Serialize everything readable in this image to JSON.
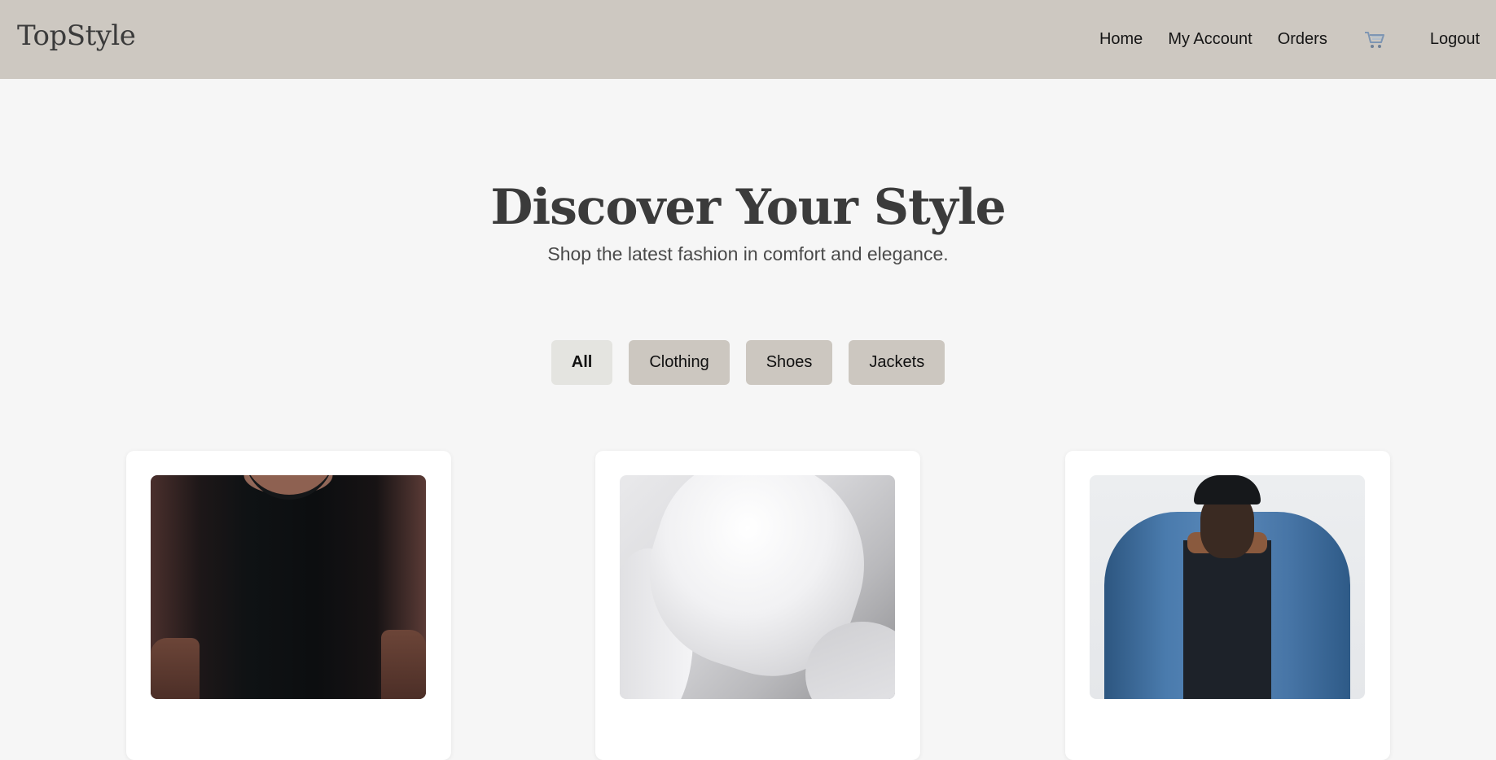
{
  "header": {
    "logo": "TopStyle",
    "nav": {
      "home": "Home",
      "account": "My Account",
      "orders": "Orders",
      "cart_icon": "shopping-cart-icon",
      "logout": "Logout"
    },
    "background_color": "#cdc8c1"
  },
  "hero": {
    "title": "Discover Your Style",
    "subtitle": "Shop the latest fashion in comfort and elegance."
  },
  "filters": {
    "active": "All",
    "items": [
      "All",
      "Clothing",
      "Shoes",
      "Jackets"
    ]
  },
  "products": [
    {
      "image": "black-tshirt"
    },
    {
      "image": "white-sneakers"
    },
    {
      "image": "denim-jacket"
    }
  ],
  "colors": {
    "page_background": "#f6f6f6",
    "button_background": "#ccc7c0",
    "active_button_background": "#e4e4e0",
    "heading_text": "#3b3b3b"
  }
}
